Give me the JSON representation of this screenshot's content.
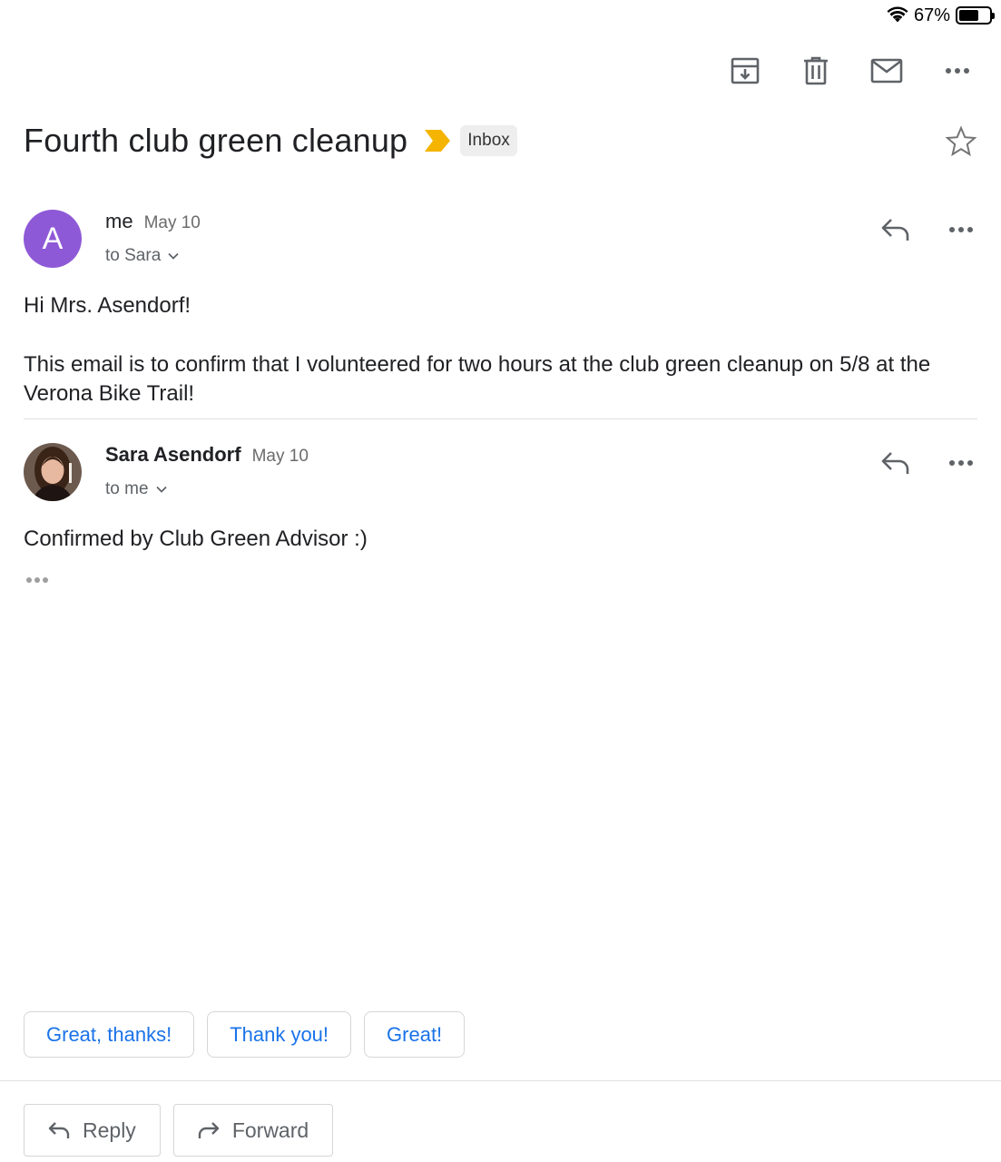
{
  "status_bar": {
    "battery_percent": "67%",
    "battery_level": 0.67,
    "wifi_icon": "wifi-icon"
  },
  "toolbar": {
    "buttons": [
      {
        "name": "archive-icon"
      },
      {
        "name": "trash-icon"
      },
      {
        "name": "mark-unread-icon"
      },
      {
        "name": "more-icon"
      }
    ]
  },
  "subject": {
    "title": "Fourth club green cleanup",
    "label_chip": "Inbox",
    "importance_color": "#f4b400"
  },
  "messages": [
    {
      "sender": "me",
      "date": "May 10",
      "recipient": "to Sara",
      "avatar_letter": "A",
      "avatar_color": "#8e59d6",
      "body": [
        "Hi Mrs. Asendorf!",
        "This email is to confirm that I volunteered for two hours at the club green cleanup on 5/8 at the Verona Bike Trail!"
      ]
    },
    {
      "sender": "Sara Asendorf",
      "date": "May 10",
      "recipient": "to me",
      "body": [
        "Confirmed by Club Green Advisor :)"
      ]
    }
  ],
  "smart_replies": [
    "Great, thanks!",
    "Thank you!",
    "Great!"
  ],
  "actions": {
    "reply": "Reply",
    "forward": "Forward"
  },
  "colors": {
    "accent": "#1a73e8",
    "muted": "#5f6368"
  }
}
